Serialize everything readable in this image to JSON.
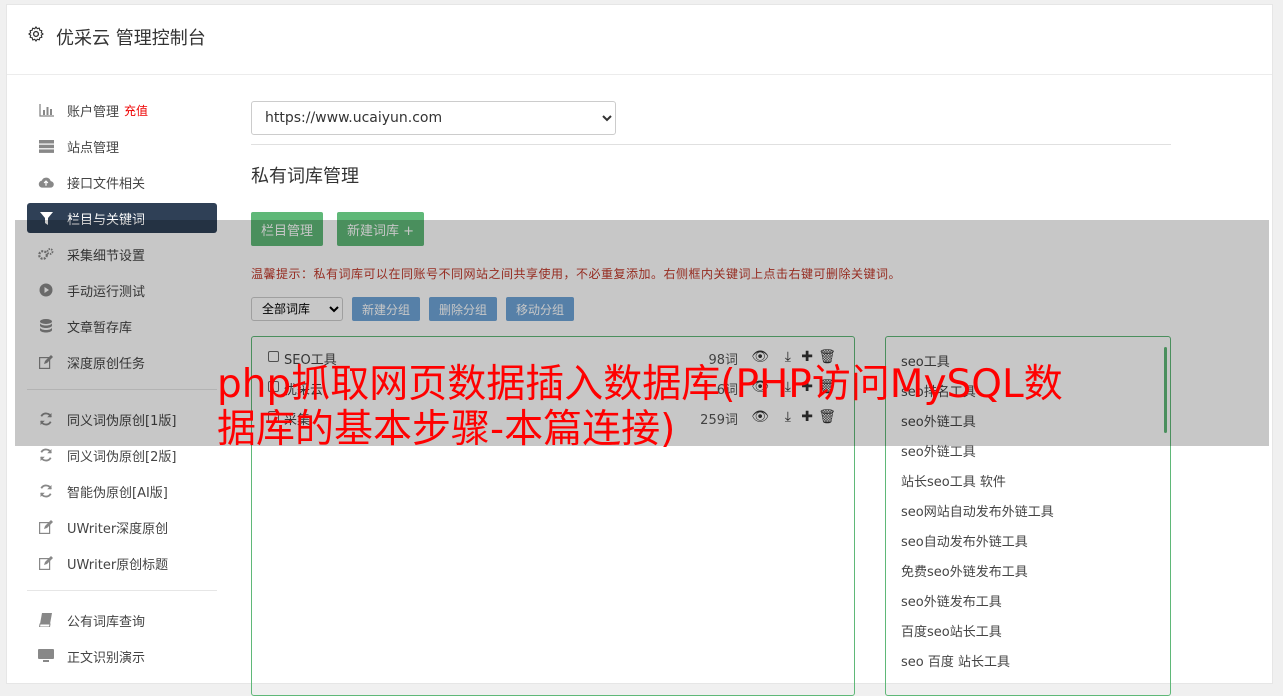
{
  "app": {
    "title": "优采云 管理控制台"
  },
  "sidebar": {
    "items": [
      {
        "icon": "bar-chart-icon",
        "label": "账户管理",
        "extra": "充值"
      },
      {
        "icon": "server-icon",
        "label": "站点管理"
      },
      {
        "icon": "cloud-upload-icon",
        "label": "接口文件相关"
      },
      {
        "icon": "filter-icon",
        "label": "栏目与关键词",
        "active": true
      },
      {
        "icon": "cogs-icon",
        "label": "采集细节设置"
      },
      {
        "icon": "play-circle-icon",
        "label": "手动运行测试"
      },
      {
        "icon": "database-icon",
        "label": "文章暂存库"
      },
      {
        "icon": "edit-icon",
        "label": "深度原创任务"
      }
    ],
    "items2": [
      {
        "icon": "refresh-icon",
        "label": "同义词伪原创[1版]"
      },
      {
        "icon": "refresh-icon",
        "label": "同义词伪原创[2版]"
      },
      {
        "icon": "refresh-icon",
        "label": "智能伪原创[AI版]"
      },
      {
        "icon": "edit-icon",
        "label": "UWriter深度原创"
      },
      {
        "icon": "edit-icon",
        "label": "UWriter原创标题"
      }
    ],
    "items3": [
      {
        "icon": "book-icon",
        "label": "公有词库查询"
      },
      {
        "icon": "monitor-icon",
        "label": "正文识别演示"
      }
    ]
  },
  "main": {
    "site_select": "https://www.ucaiyun.com",
    "section_title": "私有词库管理",
    "buttons": {
      "column_manage": "栏目管理",
      "new_library": "新建词库 +"
    },
    "tip": "温馨提示：私有词库可以在同账号不同网站之间共享使用，不必重复添加。右侧框内关键词上点击右键可删除关键词。",
    "filter_select": "全部词库",
    "group_buttons": {
      "new_group": "新建分组",
      "delete_group": "删除分组",
      "move_group": "移动分组"
    },
    "libraries": [
      {
        "name": "SEO工具",
        "count": "98词"
      },
      {
        "name": "优采云",
        "count": "6词"
      },
      {
        "name": "采集",
        "count": "259词"
      }
    ],
    "keywords": [
      "seo工具",
      "seo排名工具",
      "seo外链工具",
      "seo外链工具",
      "站长seo工具 软件",
      "seo网站自动发布外链工具",
      "seo自动发布外链工具",
      "免费seo外链发布工具",
      "seo外链发布工具",
      "百度seo站长工具",
      "seo 百度 站长工具"
    ]
  },
  "headline": "php抓取网页数据插入数据库(PHP访问MySQL数据库的基本步骤-本篇连接)",
  "colors": {
    "active_nav": "#2f4056",
    "green": "#5fb878",
    "blue": "#6fa5d8",
    "headline": "#ff0000",
    "charge": "#ee0000"
  }
}
